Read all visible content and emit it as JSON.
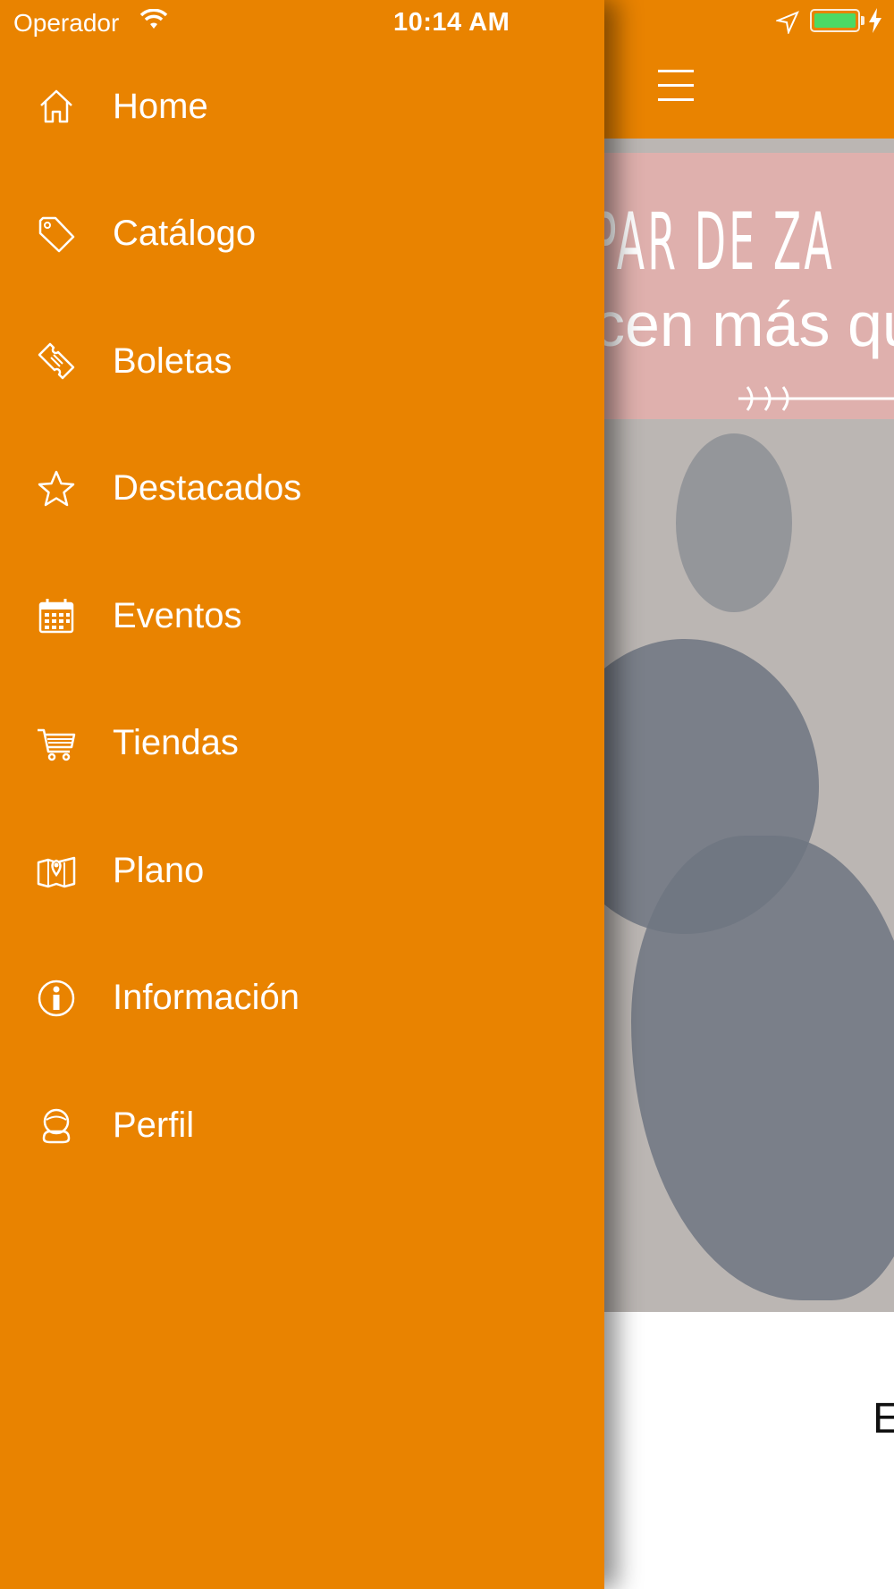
{
  "status_bar": {
    "carrier": "Operador",
    "time": "10:14 AM",
    "battery_color": "#4cd964"
  },
  "theme": {
    "accent": "#e98300"
  },
  "drawer": {
    "items": [
      {
        "label": "Home",
        "icon": "home-icon"
      },
      {
        "label": "Catálogo",
        "icon": "tag-icon"
      },
      {
        "label": "Boletas",
        "icon": "ticket-icon"
      },
      {
        "label": "Destacados",
        "icon": "star-icon"
      },
      {
        "label": "Eventos",
        "icon": "calendar-icon"
      },
      {
        "label": "Tiendas",
        "icon": "cart-icon"
      },
      {
        "label": "Plano",
        "icon": "map-icon"
      },
      {
        "label": "Información",
        "icon": "info-icon"
      },
      {
        "label": "Perfil",
        "icon": "profile-icon"
      }
    ]
  },
  "main": {
    "banner_line1": "PAR DE ZA",
    "banner_line2": "cen más qu",
    "below_text": "E"
  }
}
